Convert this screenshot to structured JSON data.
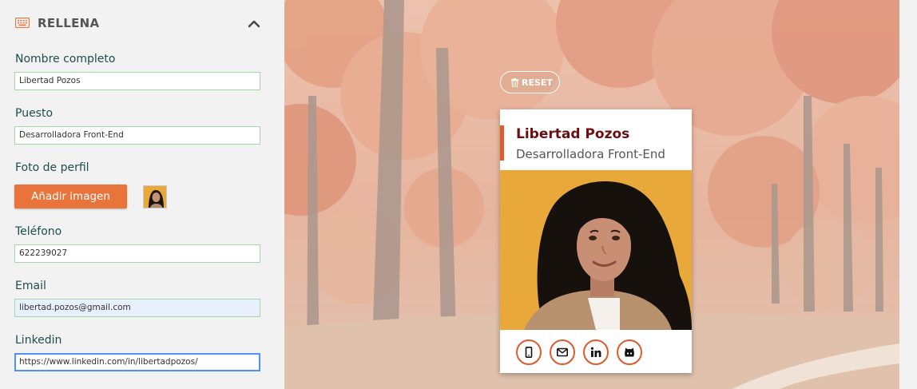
{
  "panel": {
    "title": "RELLENA",
    "icons": {
      "section": "keyboard-icon",
      "toggle": "chevron-up-icon"
    }
  },
  "form": {
    "name_label": "Nombre completo",
    "name_value": "Libertad Pozos",
    "job_label": "Puesto",
    "job_value": "Desarrolladora Front-End",
    "photo_label": "Foto de perfil",
    "add_image_button": "Añadir imagen",
    "phone_label": "Teléfono",
    "phone_value": "622239027",
    "email_label": "Email",
    "email_value": "libertad.pozos@gmail.com",
    "linkedin_label": "Linkedin",
    "linkedin_value": "https://www.linkedin.com/in/libertadpozos/"
  },
  "preview": {
    "reset_label": "RESET",
    "card": {
      "name": "Libertad Pozos",
      "job": "Desarrolladora Front-End",
      "social_icons": [
        "mobile-icon",
        "envelope-icon",
        "linkedin-icon",
        "github-icon"
      ]
    }
  },
  "colors": {
    "accent": "#e8743b",
    "social_border": "#e05a2b",
    "card_name": "#6b0f0f",
    "label": "#1e4d4a",
    "field_border": "#a3d9a5",
    "focus_border": "#4d90fe",
    "autofill_bg": "#e8f0fe",
    "photo_bg": "#e8a93a"
  }
}
